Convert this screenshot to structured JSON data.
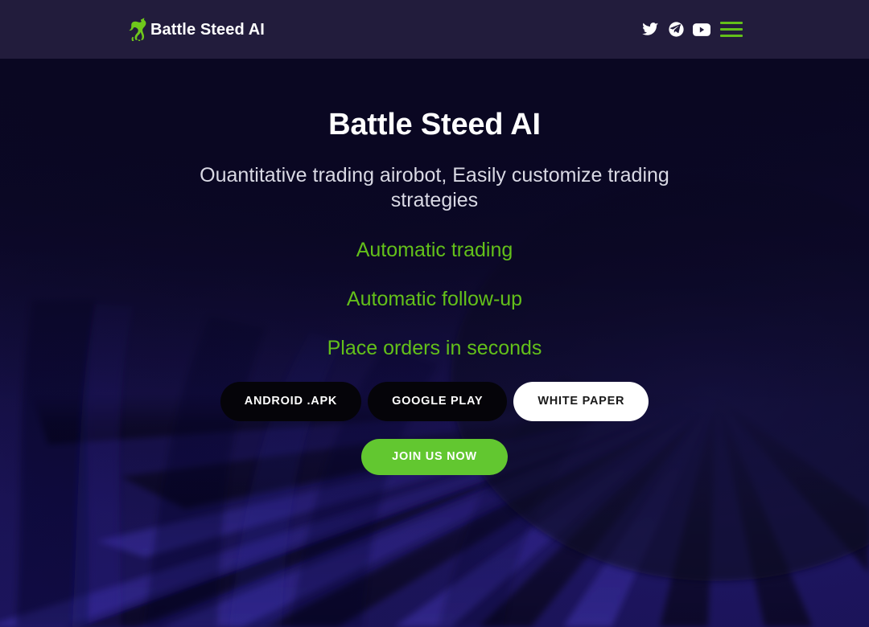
{
  "header": {
    "brand_name": "Battle Steed AI",
    "logo_icon": "green-horse-icon",
    "social": [
      {
        "name": "twitter-icon",
        "label": "Twitter"
      },
      {
        "name": "telegram-icon",
        "label": "Telegram"
      },
      {
        "name": "youtube-icon",
        "label": "YouTube"
      }
    ],
    "menu_icon": "hamburger-menu-icon",
    "background_color": "#221c3c"
  },
  "hero": {
    "title": "Battle Steed AI",
    "subtitle": "Ouantitative trading airobot, Easily customize trading strategies",
    "features": [
      "Automatic trading",
      "Automatic follow-up",
      "Place orders in seconds"
    ],
    "buttons": [
      {
        "label": "ANDROID .APK",
        "style": "dark"
      },
      {
        "label": "GOOGLE PLAY",
        "style": "dark"
      },
      {
        "label": "WHITE PAPER",
        "style": "light"
      }
    ],
    "cta": {
      "label": "JOIN US NOW"
    },
    "background_color": "#0d0a28"
  },
  "colors": {
    "accent_green": "#63c01a",
    "cta_green": "#62c730",
    "header_bg": "#221c3c",
    "hero_bg": "#0d0a28",
    "text_white": "#ffffff",
    "text_muted": "#d9d9e4"
  }
}
